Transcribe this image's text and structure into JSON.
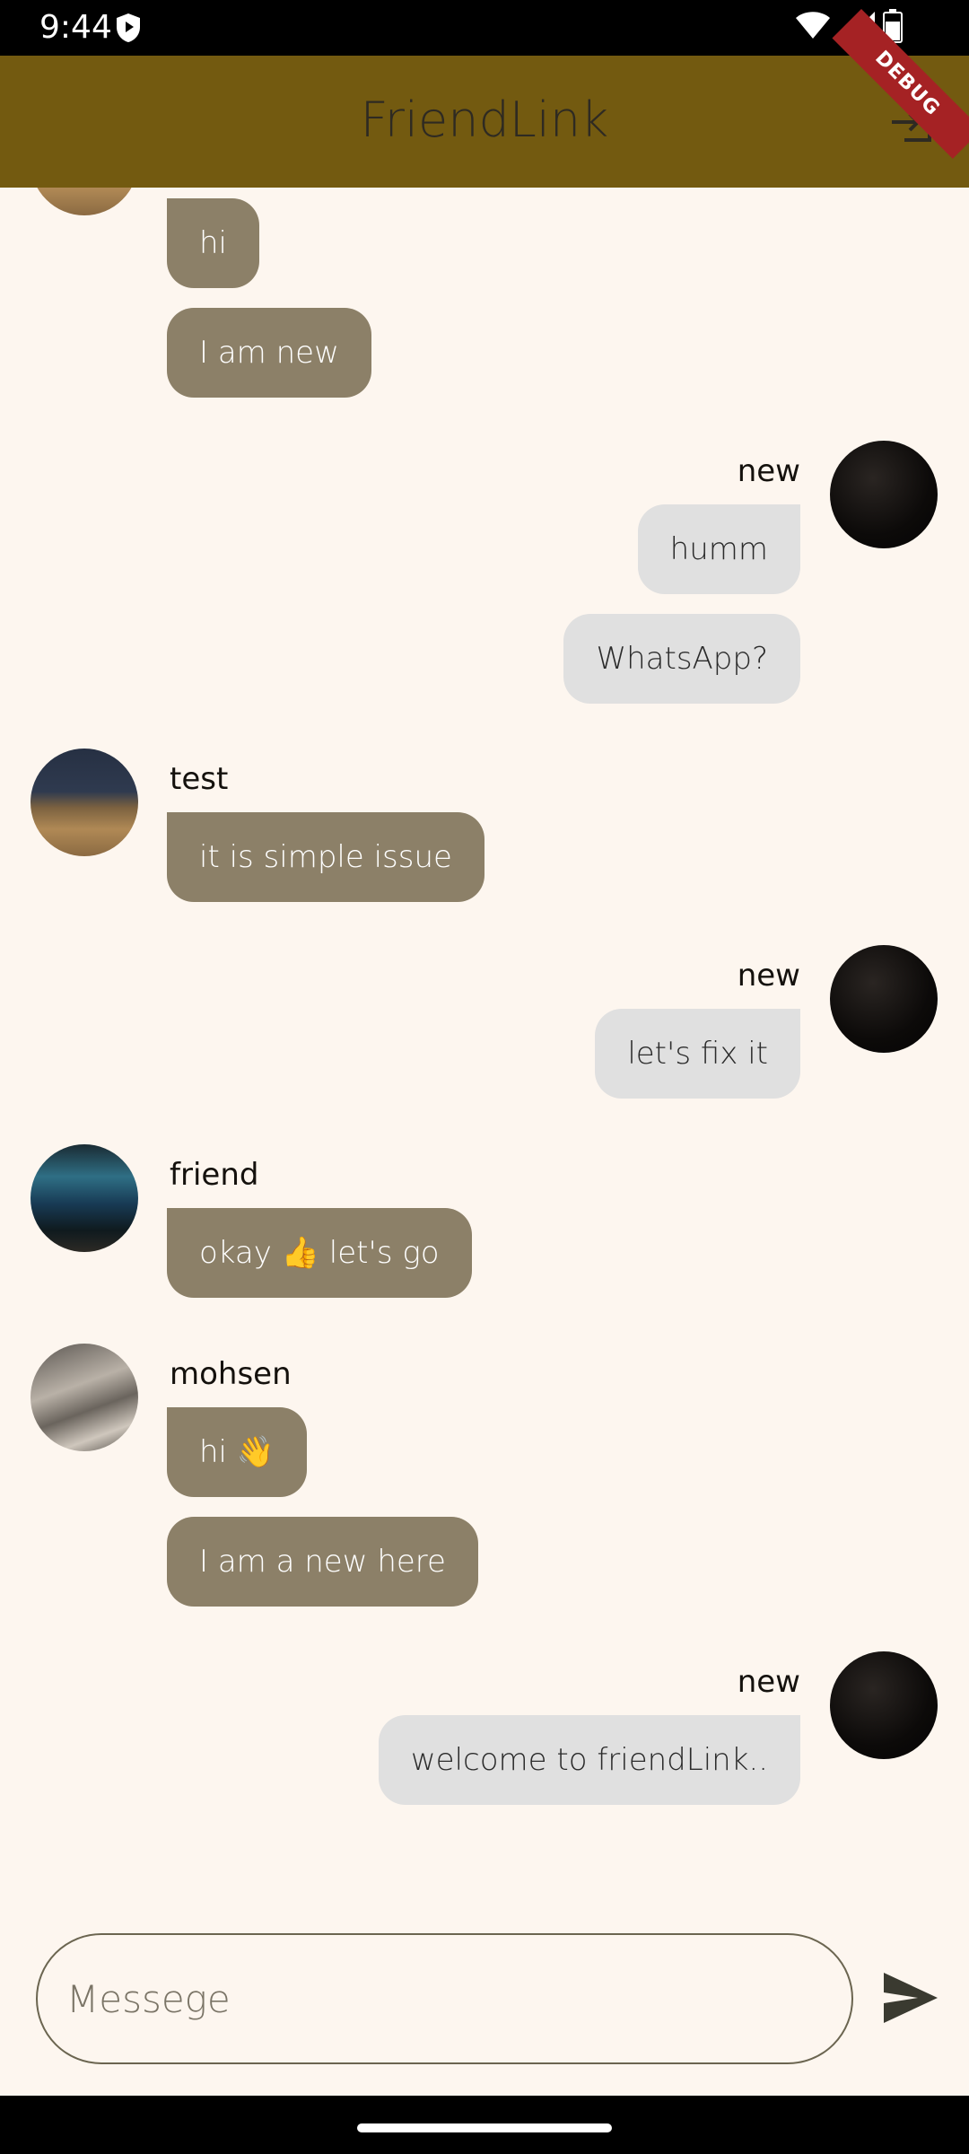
{
  "status_bar": {
    "time": "9:44",
    "debug_label": "DEBUG"
  },
  "app_bar": {
    "title": "FriendLink"
  },
  "messages": {
    "m1": {
      "text": "hi"
    },
    "m2": {
      "text": "I am new"
    },
    "g2": {
      "sender": "new"
    },
    "m3": {
      "text": "humm"
    },
    "m4": {
      "text": "WhatsApp?"
    },
    "g3": {
      "sender": "test"
    },
    "m5": {
      "text": "it is simple issue"
    },
    "g4": {
      "sender": "new"
    },
    "m6": {
      "text": "let's fix it"
    },
    "g5": {
      "sender": "friend"
    },
    "m7": {
      "text": "okay 👍  let's go"
    },
    "g6": {
      "sender": "mohsen"
    },
    "m8": {
      "text": "hi 👋"
    },
    "m9": {
      "text": "I am a new here"
    },
    "g7": {
      "sender": "new"
    },
    "m10": {
      "text": "welcome to friendLink.."
    }
  },
  "composer": {
    "placeholder": "Messege"
  },
  "icons": {
    "status": [
      "shield-icon",
      "wifi-icon",
      "signal-icon",
      "battery-icon"
    ],
    "app_bar": "logout-icon",
    "composer": "send-icon"
  },
  "colors": {
    "app_bar": "#735a10",
    "background": "#fdf6ef",
    "incoming_bubble": "#8c8068",
    "outgoing_bubble": "#e0e0e0",
    "debug_banner": "#a52224"
  }
}
